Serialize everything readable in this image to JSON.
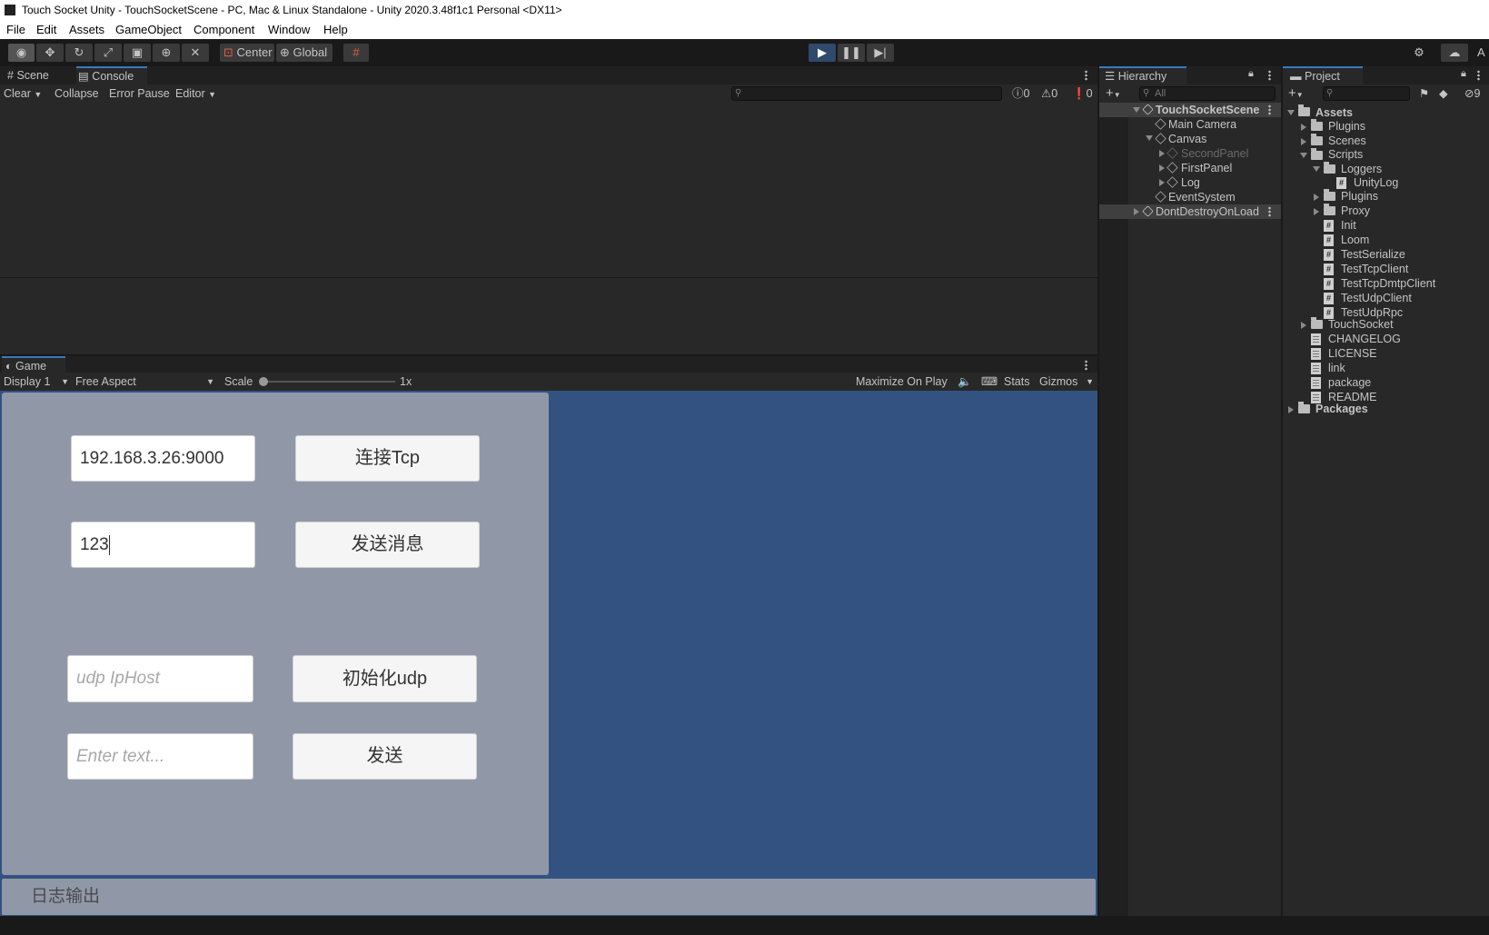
{
  "window": {
    "title": "Touch Socket Unity - TouchSocketScene - PC, Mac & Linux Standalone - Unity 2020.3.48f1c1 Personal <DX11>"
  },
  "menu": [
    "File",
    "Edit",
    "Assets",
    "GameObject",
    "Component",
    "Window",
    "Help"
  ],
  "toolbar": {
    "center_label": "Center",
    "global_label": "Global",
    "account_initial": "A"
  },
  "tabs": {
    "scene": "Scene",
    "console": "Console",
    "game": "Game",
    "hierarchy": "Hierarchy",
    "project": "Project"
  },
  "console": {
    "clear": "Clear",
    "collapse": "Collapse",
    "error_pause": "Error Pause",
    "editor": "Editor",
    "log_count": "0",
    "warn_count": "0",
    "error_count": "0"
  },
  "game_view": {
    "display": "Display 1",
    "aspect": "Free Aspect",
    "scale_label": "Scale",
    "scale_value": "1x",
    "maximize": "Maximize On Play",
    "stats": "Stats",
    "gizmos": "Gizmos",
    "tcp_host_value": "192.168.3.26:9000",
    "connect_tcp_label": "连接Tcp",
    "message_value": "123",
    "send_message_label": "发送消息",
    "udp_host_placeholder": "udp IpHost",
    "init_udp_label": "初始化udp",
    "udp_text_placeholder": "Enter text...",
    "send_label": "发送",
    "log_output": "日志输出"
  },
  "hierarchy": {
    "search_placeholder": "All",
    "items": [
      "TouchSocketScene",
      "Main Camera",
      "Canvas",
      "SecondPanel",
      "FirstPanel",
      "Log",
      "EventSystem",
      "DontDestroyOnLoad"
    ]
  },
  "project": {
    "hidden_count": "9",
    "items": [
      "Assets",
      "Plugins",
      "Scenes",
      "Scripts",
      "Loggers",
      "UnityLog",
      "Plugins",
      "Proxy",
      "Init",
      "Loom",
      "TestSerialize",
      "TestTcpClient",
      "TestTcpDmtpClient",
      "TestUdpClient",
      "TestUdpRpc",
      "TouchSocket",
      "CHANGELOG",
      "LICENSE",
      "link",
      "package",
      "README",
      "Packages"
    ]
  },
  "colors": {
    "game_background": "#335281",
    "canvas_panel": "#9098a8",
    "selection": "#3f3f3f",
    "accent": "#3a79bb"
  }
}
